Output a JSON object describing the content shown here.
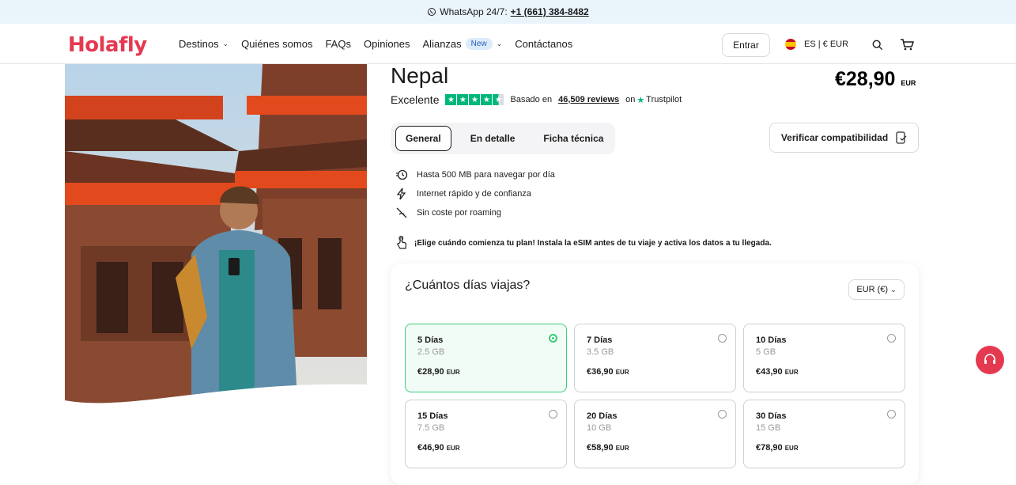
{
  "topbar": {
    "whatsapp_label": "WhatsApp 24/7:",
    "phone": "+1 (661) 384-8482"
  },
  "nav": {
    "logo": "Holafly",
    "items": [
      {
        "label": "Destinos",
        "has_dropdown": true
      },
      {
        "label": "Quiénes somos"
      },
      {
        "label": "FAQs"
      },
      {
        "label": "Opiniones"
      },
      {
        "label": "Alianzas",
        "badge": "New",
        "has_dropdown": true
      },
      {
        "label": "Contáctanos"
      }
    ],
    "login_label": "Entrar",
    "locale_label": "ES | € EUR"
  },
  "product": {
    "title": "Nepal",
    "price": "€28,90",
    "price_currency": "EUR",
    "rating": {
      "label": "Excelente",
      "based_on": "Basado en",
      "review_count": "46,509 reviews",
      "on": "on",
      "provider": "Trustpilot",
      "stars": 4.5
    }
  },
  "tabs": [
    {
      "label": "General",
      "active": true
    },
    {
      "label": "En detalle"
    },
    {
      "label": "Ficha técnica"
    }
  ],
  "compat_button": "Verificar compatibilidad",
  "features": [
    {
      "icon": "clock-data-icon",
      "text": "Hasta 500 MB para navegar por día"
    },
    {
      "icon": "lightning-icon",
      "text": "Internet rápido y de confianza"
    },
    {
      "icon": "no-roaming-icon",
      "text": "Sin coste por roaming"
    }
  ],
  "notice": "¡Elige cuándo comienza tu plan! Instala la eSIM antes de tu viaje y activa los datos a tu llegada.",
  "plans_card": {
    "title": "¿Cuántos días viajas?",
    "currency_select": "EUR (€)",
    "plans": [
      {
        "days": "5 Días",
        "gb": "2.5 GB",
        "price": "€28,90",
        "currency": "EUR",
        "selected": true
      },
      {
        "days": "7 Días",
        "gb": "3.5 GB",
        "price": "€36,90",
        "currency": "EUR"
      },
      {
        "days": "10 Días",
        "gb": "5 GB",
        "price": "€43,90",
        "currency": "EUR"
      },
      {
        "days": "15 Días",
        "gb": "7.5 GB",
        "price": "€46,90",
        "currency": "EUR"
      },
      {
        "days": "20 Días",
        "gb": "10 GB",
        "price": "€58,90",
        "currency": "EUR"
      },
      {
        "days": "30 Días",
        "gb": "15 GB",
        "price": "€78,90",
        "currency": "EUR"
      }
    ]
  },
  "colors": {
    "brand": "#e5394f",
    "accent_green": "#3ccc7a",
    "trustpilot": "#00b67a"
  }
}
